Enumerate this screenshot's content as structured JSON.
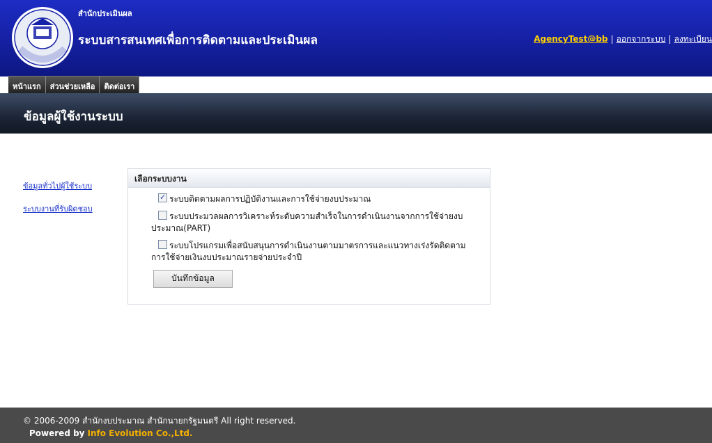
{
  "header": {
    "org_name": "สำนักประเมินผล",
    "system_name": "ระบบสารสนเทศเพื่อการติดตามและประเมินผล",
    "logo_icon": "budget-bureau-seal-icon",
    "logo_text": "สำนักงบประมาณ",
    "user_link": "AgencyTest@bb",
    "logout_link": "ออกจากระบบ",
    "register_link": "ลงทะเบียน"
  },
  "nav": {
    "tabs": [
      "หน้าแรก",
      "ส่วนช่วยเหลือ",
      "ติดต่อเรา"
    ]
  },
  "page": {
    "title": "ข้อมูลผู้ใช้งานระบบ"
  },
  "leftmenu": {
    "items": [
      "ข้อมูลทั่วไปผู้ใช้ระบบ",
      "ระบบงานที่รับผิดชอบ"
    ]
  },
  "panel": {
    "heading": "เลือกระบบงาน",
    "options": [
      {
        "label": "ระบบติดตามผลการปฏิบัติงานและการใช้จ่ายงบประมาณ",
        "cont": "",
        "checked": true
      },
      {
        "label": "ระบบประมวลผลการวิเคราะห์ระดับความสำเร็จในการดำเนินงานจากการใช้จ่ายงบ",
        "cont": "ประมาณ(PART)",
        "checked": false
      },
      {
        "label": "ระบบโปรแกรมเพื่อสนับสนุนการดำเนินงานตามมาตรการและแนวทางเร่งรัดติดตาม",
        "cont": "การใช้จ่ายเงินงบประมาณรายจ่ายประจำปี",
        "checked": false
      }
    ],
    "save_label": "บันทึกข้อมูล"
  },
  "footer": {
    "copyright": "© 2006-2009 สำนักงบประมาณ สำนักนายกรัฐมนตรี All right reserved.",
    "powered_by": "Powered by",
    "company": "Info Evolution Co.,Ltd."
  },
  "colors": {
    "header_blue": "#1622a8",
    "link_yellow": "#ffd200",
    "link_blue": "#1a33c8",
    "footer_gray": "#4a4a4a",
    "company_orange": "#f4b000"
  }
}
